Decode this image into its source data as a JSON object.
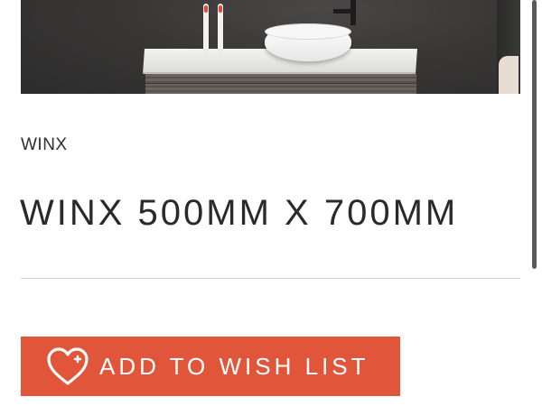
{
  "product": {
    "brand": "WINX",
    "title": "WINX 500MM X 700MM"
  },
  "actions": {
    "wish_list_label": "ADD TO WISH LIST"
  },
  "colors": {
    "accent": "#e1563a",
    "text": "#2a2a2a",
    "divider": "#cfcfcf"
  },
  "icons": {
    "wish": "heart-outline-icon"
  }
}
